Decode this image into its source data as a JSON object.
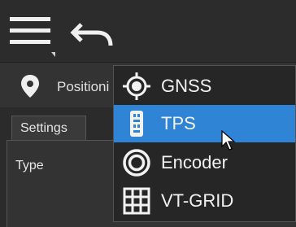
{
  "toolbar": {
    "menu_icon": "hamburger-menu-icon",
    "undo_icon": "undo-icon"
  },
  "position_bar": {
    "icon": "location-pin-icon",
    "label": "Positioni"
  },
  "settings": {
    "tab_label": "Settings",
    "type_label": "Type"
  },
  "dropdown": {
    "selected_index": 1,
    "highlight_color": "#2f84d6",
    "items": [
      {
        "label": "GNSS",
        "icon": "gnss-crosshair-icon"
      },
      {
        "label": "TPS",
        "icon": "tps-prism-icon"
      },
      {
        "label": "Encoder",
        "icon": "encoder-rings-icon"
      },
      {
        "label": "VT-GRID",
        "icon": "grid-icon"
      }
    ]
  }
}
